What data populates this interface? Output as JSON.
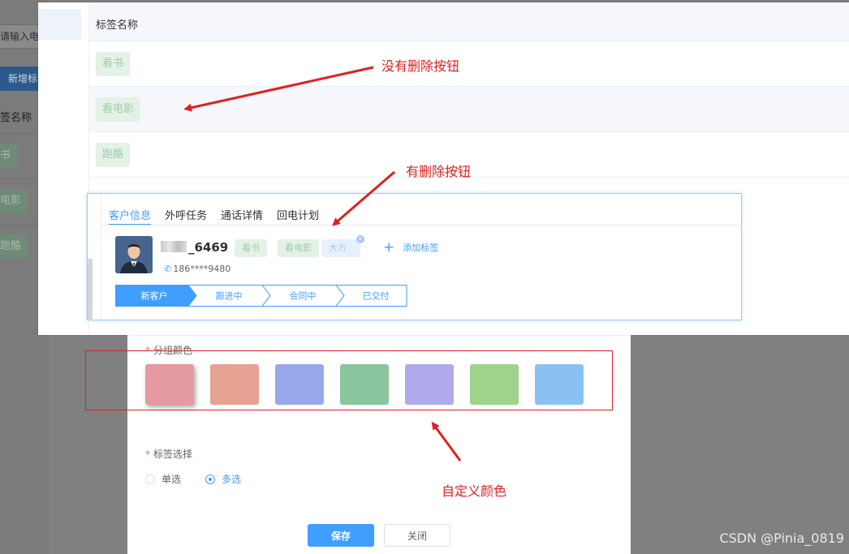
{
  "background_page": {
    "search_placeholder": "请输入电",
    "add_button": "新增标",
    "column_header": "签名称",
    "tags": [
      "书",
      "电影",
      "跑酪"
    ]
  },
  "tag_table": {
    "column_header": "标签名称",
    "rows": [
      "看书",
      "看电影",
      "跑酪"
    ]
  },
  "customer_card": {
    "tabs": [
      "客户信息",
      "外呼任务",
      "通话详情",
      "回电计划"
    ],
    "active_tab": 0,
    "name_suffix": "_6469",
    "phone": "186****9480",
    "tags": [
      "看书",
      "看电影",
      "大方"
    ],
    "add_tag_label": "添加标签",
    "steps": [
      "新客户",
      "跟进中",
      "合同中",
      "已交付"
    ],
    "active_step": 0
  },
  "dialog": {
    "group_color_label": "分组颜色",
    "colors": [
      "#e49aa0",
      "#e6a293",
      "#99a8ea",
      "#8bc59e",
      "#aeaaec",
      "#9ed28d",
      "#8bc1f2"
    ],
    "selected_color": 0,
    "tag_select_label": "标签选择",
    "radio_options": [
      "单选",
      "多选"
    ],
    "radio_selected": 1,
    "save_button": "保存",
    "close_button": "关闭"
  },
  "annotations": {
    "no_delete": "没有删除按钮",
    "has_delete": "有删除按钮",
    "custom_color": "自定义颜色"
  },
  "watermark": "CSDN @Pinia_0819",
  "theme": {
    "primary": "#409eff",
    "annotation_red": "#e02020"
  }
}
